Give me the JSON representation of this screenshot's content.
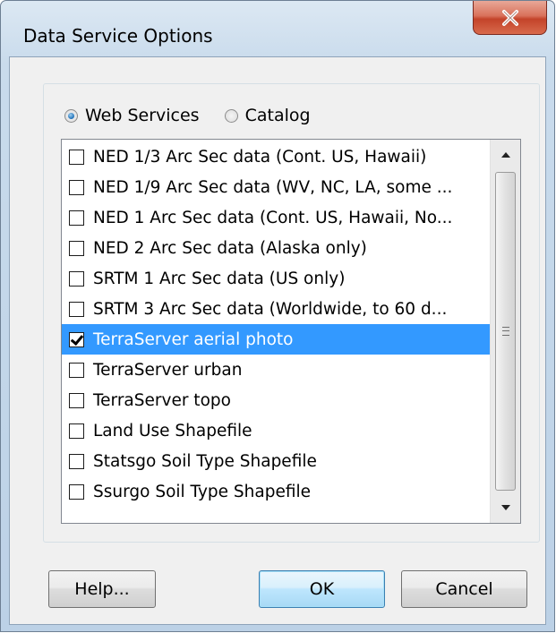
{
  "window": {
    "title": "Data Service Options",
    "close_glyph": "x"
  },
  "source": {
    "options": [
      {
        "label": "Web Services",
        "selected": true
      },
      {
        "label": "Catalog",
        "selected": false
      }
    ]
  },
  "list": {
    "items": [
      {
        "label": "NED 1/3 Arc Sec data (Cont. US, Hawaii)",
        "checked": false,
        "selected": false
      },
      {
        "label": "NED 1/9 Arc Sec data (WV, NC, LA, some ...",
        "checked": false,
        "selected": false
      },
      {
        "label": "NED 1 Arc Sec data (Cont. US, Hawaii, No...",
        "checked": false,
        "selected": false
      },
      {
        "label": "NED 2 Arc Sec data (Alaska only)",
        "checked": false,
        "selected": false
      },
      {
        "label": "SRTM 1 Arc Sec data (US only)",
        "checked": false,
        "selected": false
      },
      {
        "label": "SRTM 3 Arc Sec data (Worldwide, to 60 d...",
        "checked": false,
        "selected": false
      },
      {
        "label": "TerraServer aerial photo",
        "checked": true,
        "selected": true
      },
      {
        "label": "TerraServer urban",
        "checked": false,
        "selected": false
      },
      {
        "label": "TerraServer topo",
        "checked": false,
        "selected": false
      },
      {
        "label": "Land Use Shapefile",
        "checked": false,
        "selected": false
      },
      {
        "label": "Statsgo Soil Type Shapefile",
        "checked": false,
        "selected": false
      },
      {
        "label": "Ssurgo Soil Type Shapefile",
        "checked": false,
        "selected": false
      }
    ]
  },
  "buttons": {
    "help": "Help...",
    "ok": "OK",
    "cancel": "Cancel"
  },
  "colors": {
    "selection": "#3399ff",
    "close_button": "#c3432a"
  }
}
